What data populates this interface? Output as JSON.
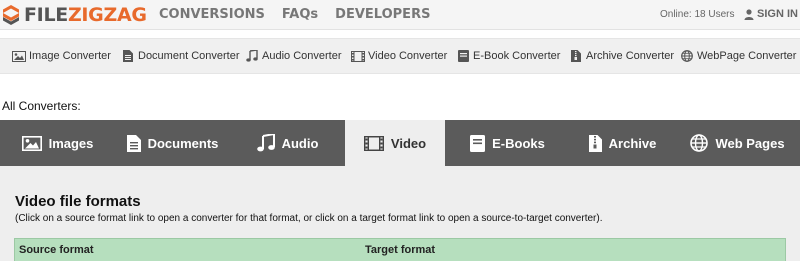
{
  "header": {
    "logo": {
      "part1": "FILE",
      "part2": "ZIGZAG"
    },
    "nav": [
      "CONVERSIONS",
      "FAQs",
      "DEVELOPERS"
    ],
    "online": "Online: 18 Users",
    "signin": "SIGN IN"
  },
  "quickbar": {
    "items": [
      {
        "label": "Image Converter",
        "icon": "image-icon"
      },
      {
        "label": "Document Converter",
        "icon": "document-icon"
      },
      {
        "label": "Audio Converter",
        "icon": "music-icon"
      },
      {
        "label": "Video Converter",
        "icon": "film-icon"
      },
      {
        "label": "E-Book Converter",
        "icon": "book-icon"
      },
      {
        "label": "Archive Converter",
        "icon": "archive-icon"
      },
      {
        "label": "WebPage Converter",
        "icon": "globe-icon"
      }
    ]
  },
  "all_converters_label": "All Converters:",
  "tabs": [
    {
      "label": "Images",
      "icon": "image-icon"
    },
    {
      "label": "Documents",
      "icon": "document-icon"
    },
    {
      "label": "Audio",
      "icon": "music-icon"
    },
    {
      "label": "Video",
      "icon": "film-icon",
      "active": true
    },
    {
      "label": "E-Books",
      "icon": "book-icon"
    },
    {
      "label": "Archive",
      "icon": "archive-icon"
    },
    {
      "label": "Web Pages",
      "icon": "globe-icon"
    }
  ],
  "content": {
    "title": "Video file formats",
    "description": "(Click on a source format link to open a converter for that format, or click on a target format link to open a source-to-target converter).",
    "table_headers": {
      "source": "Source format",
      "target": "Target format"
    }
  },
  "colors": {
    "brand_orange": "#e86a2c",
    "tab_bar": "#5b5b5b",
    "active_tab": "#eeeeee",
    "table_header": "#b6dfbe"
  }
}
